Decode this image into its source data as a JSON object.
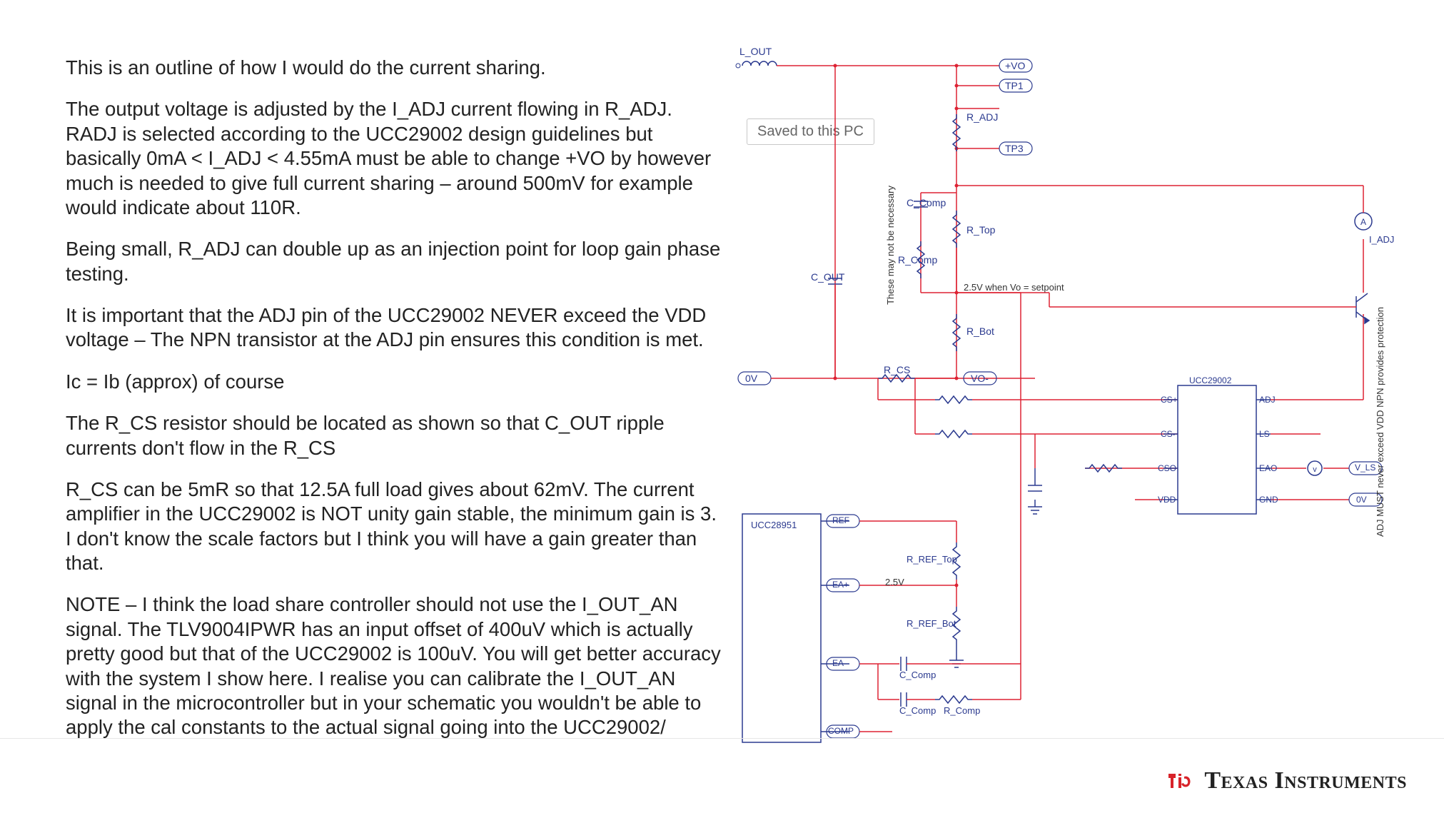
{
  "badge": {
    "text": "Saved to this PC"
  },
  "text": {
    "p1": "This is an outline of how I would do the current sharing.",
    "p2": "The output voltage is adjusted by the I_ADJ current flowing in R_ADJ. RADJ is selected according to the UCC29002 design guidelines but basically 0mA < I_ADJ < 4.55mA must be able to change +VO by however much is needed to give full current sharing – around 500mV for example would indicate about 110R.",
    "p3": "Being small, R_ADJ can double up as an injection point for loop gain phase testing.",
    "p4": "It is important that the ADJ pin of the UCC29002 NEVER exceed the VDD voltage – The NPN transistor at the ADJ pin ensures this condition is met.",
    "p5": "Ic = Ib (approx) of course",
    "p6": "The R_CS resistor should be located as shown so that C_OUT ripple currents don't flow in the R_CS",
    "p7": "R_CS can be 5mR so that 12.5A full load gives about 62mV. The current amplifier in the UCC29002 is NOT unity gain stable, the minimum gain is 3. I don't know the scale factors but I think you will have a gain greater than that.",
    "p8": "NOTE – I think the load share controller should not use the I_OUT_AN signal. The TLV9004IPWR has an input offset of 400uV which is actually pretty good but that of the UCC29002 is 100uV. You will get better accuracy with the system I show here. I realise you can calibrate the I_OUT_AN signal in the microcontroller but in your schematic you wouldn't be able to apply the cal constants to the actual signal going into the UCC29002/"
  },
  "schematic": {
    "nets": {
      "l_out": "L_OUT",
      "vo_plus": "+VO",
      "tp1": "TP1",
      "tp3": "TP3",
      "vo_minus": "VO-",
      "zero_v_left": "0V",
      "zero_v_right": "0V",
      "v_ls": "V_LS",
      "i_adj": "I_ADJ"
    },
    "components": {
      "r_adj": "R_ADJ",
      "r_top": "R_Top",
      "r_bot": "R_Bot",
      "r_cs": "R_CS",
      "c_out": "C_OUT",
      "c_comp1": "C_Comp",
      "r_comp1": "R_Comp",
      "r_ref_top": "R_REF_Top",
      "r_ref_bot": "R_REF_Bot",
      "c_comp2": "C_Comp",
      "c_comp3": "C_Comp",
      "r_comp2": "R_Comp"
    },
    "notes": {
      "maybe": "These may not be necessary",
      "setpoint": "2.5V when Vo = setpoint",
      "npn": "ADJ MUST never exceed VDD\nNPN provides protection",
      "ea_plus_val": "2.5V"
    },
    "chips": {
      "ucc29002": {
        "name": "UCC29002",
        "pins": {
          "csp": "CS+",
          "csn": "CS-",
          "cso": "CSO",
          "vdd": "VDD",
          "adj": "ADJ",
          "ls": "LS",
          "eao": "EAO",
          "gnd": "GND"
        }
      },
      "ucc28951": {
        "name": "UCC28951",
        "pins": {
          "ref": "REF",
          "eap": "EA+",
          "ean": "EA-",
          "comp": "COMP"
        }
      }
    }
  },
  "brand": {
    "name": "Texas Instruments"
  }
}
